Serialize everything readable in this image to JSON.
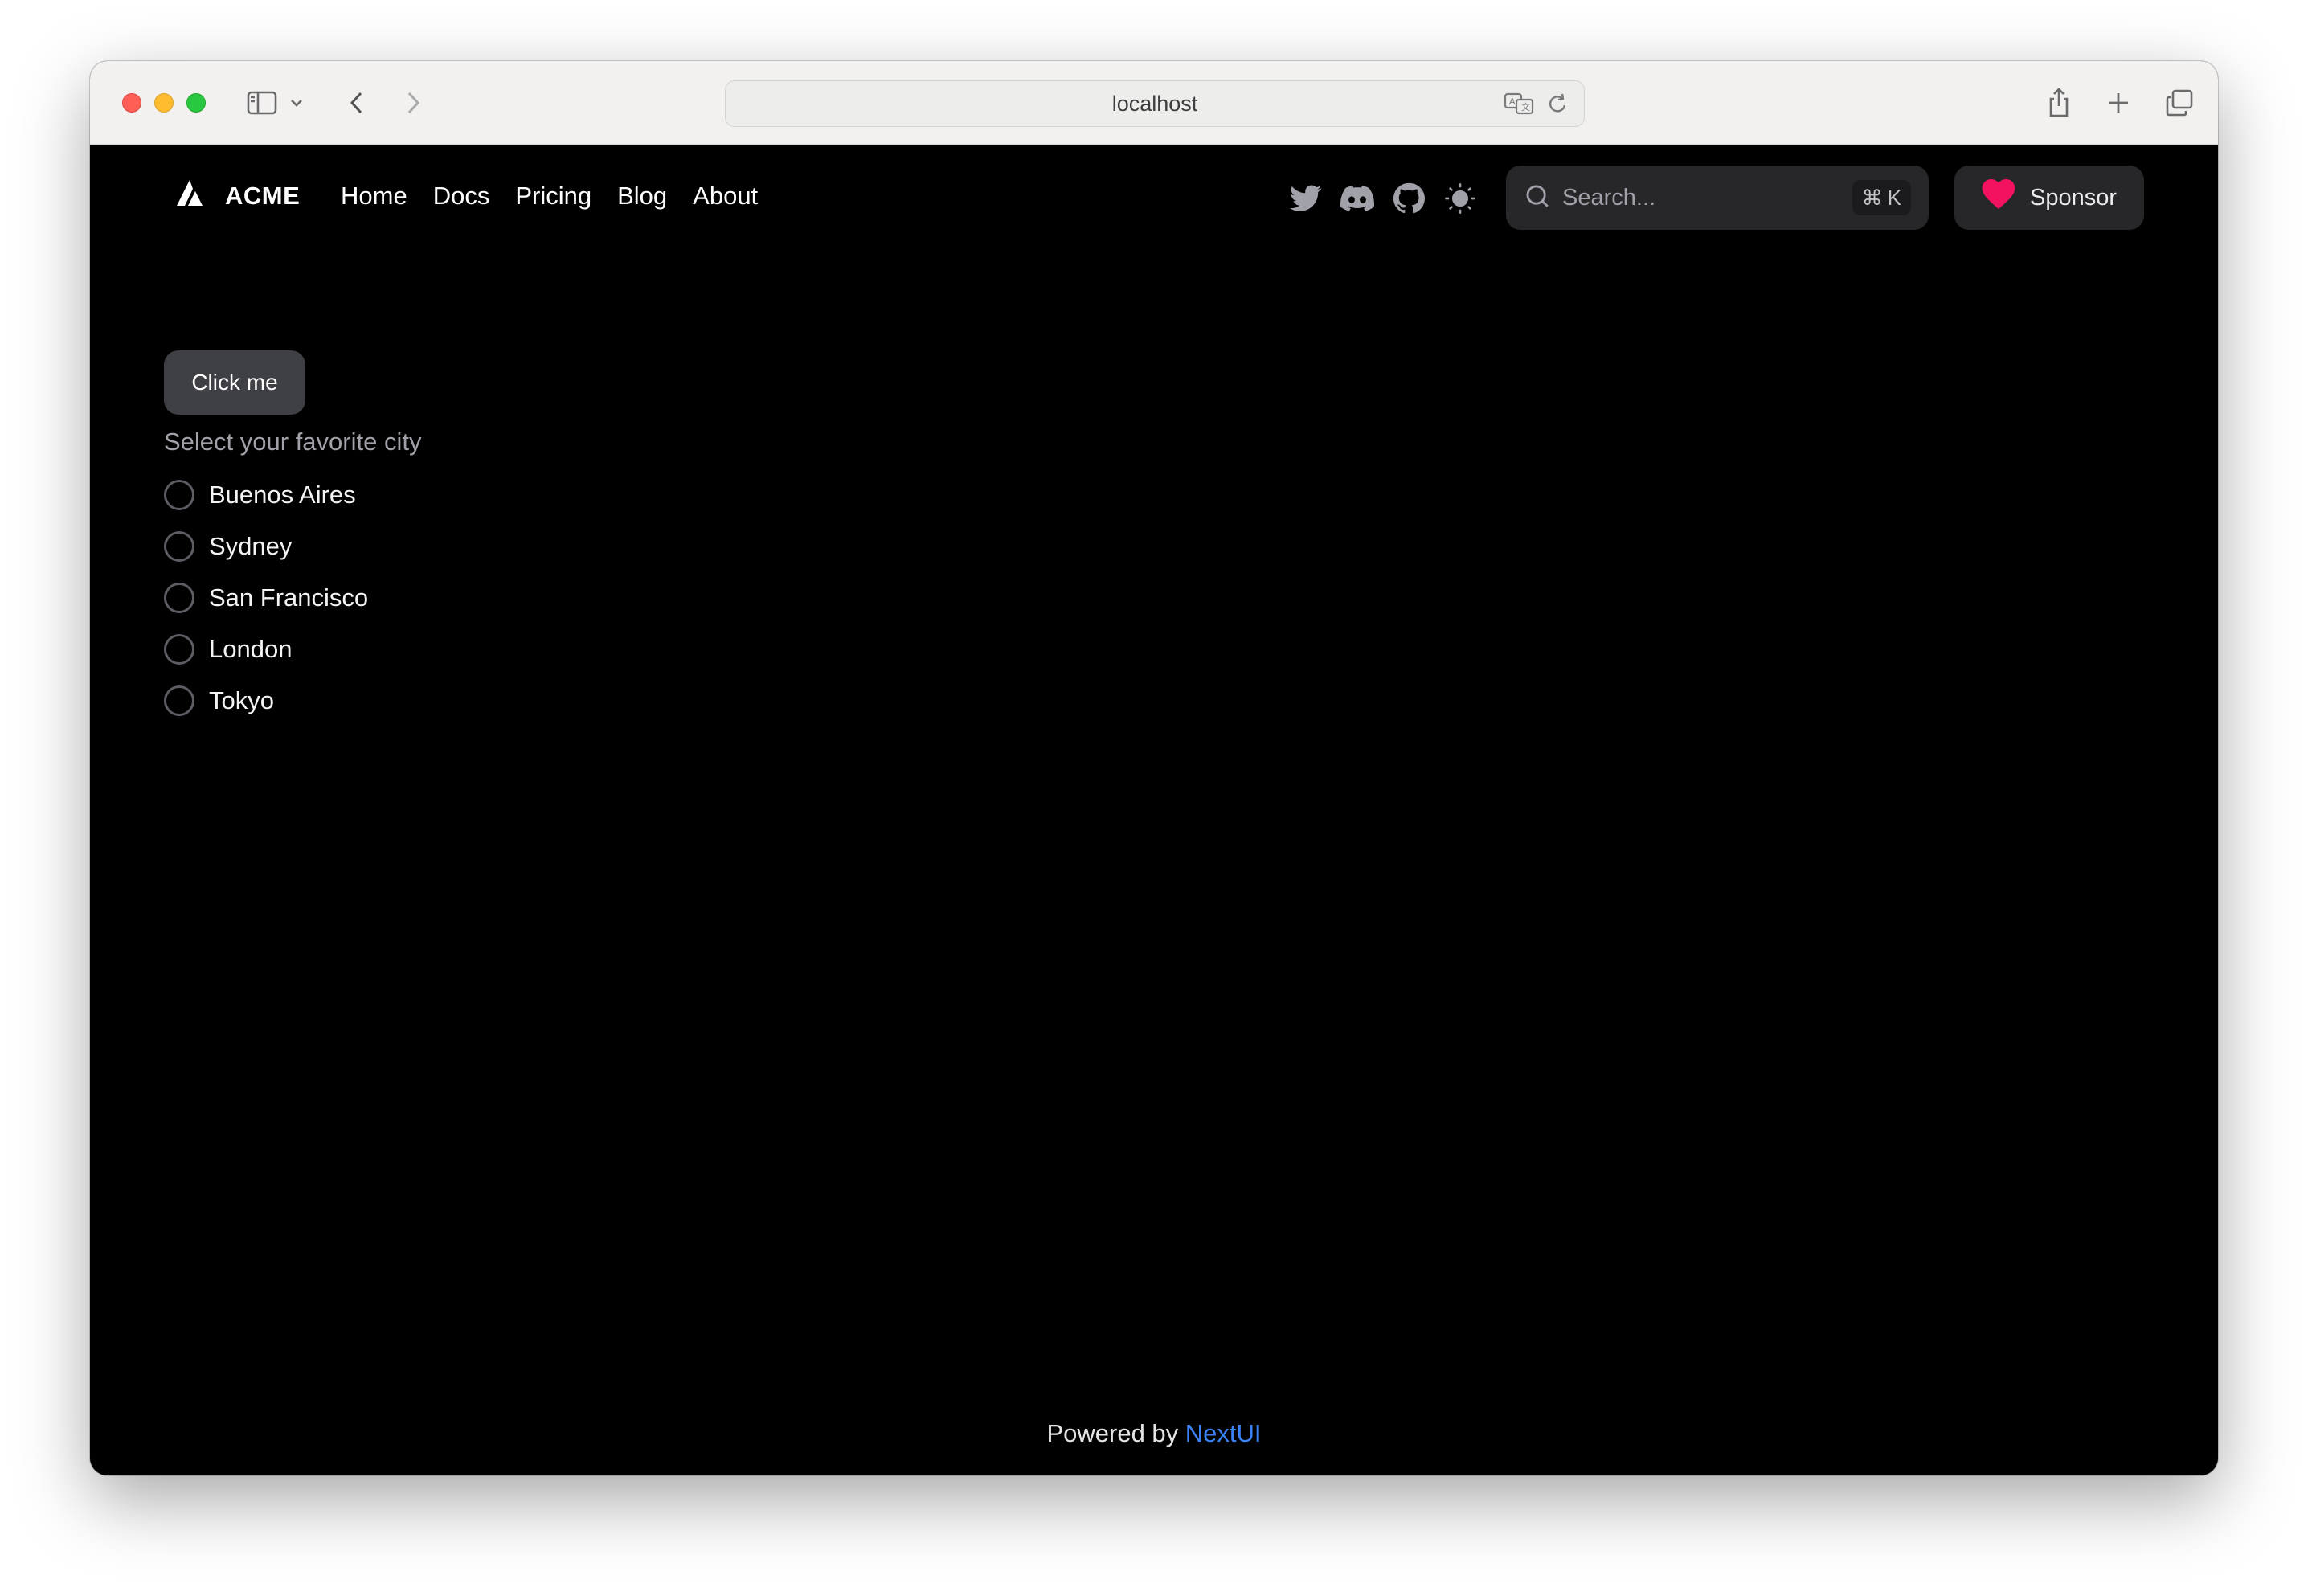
{
  "browser": {
    "url": "localhost",
    "icons": [
      "sidebar-icon",
      "chevron-down-icon",
      "back-icon",
      "forward-icon",
      "translate-icon",
      "reload-icon",
      "share-icon",
      "new-tab-icon",
      "tabs-overview-icon"
    ]
  },
  "navbar": {
    "brand": "ACME",
    "links": [
      "Home",
      "Docs",
      "Pricing",
      "Blog",
      "About"
    ],
    "social_icons": [
      "twitter-icon",
      "discord-icon",
      "github-icon",
      "theme-toggle-icon"
    ],
    "search": {
      "placeholder": "Search...",
      "shortcut_symbol": "⌘",
      "shortcut_key": "K"
    },
    "sponsor_label": "Sponsor"
  },
  "main": {
    "button_label": "Click me",
    "radio_group": {
      "label": "Select your favorite city",
      "options": [
        "Buenos Aires",
        "Sydney",
        "San Francisco",
        "London",
        "Tokyo"
      ]
    }
  },
  "footer": {
    "prefix": "Powered by",
    "link": "NextUI"
  },
  "colors": {
    "background": "#000000",
    "surface": "#27272a",
    "button": "#3f3f46",
    "muted_text": "#a1a1aa",
    "link": "#3b82f6",
    "heart": "#f31260"
  }
}
